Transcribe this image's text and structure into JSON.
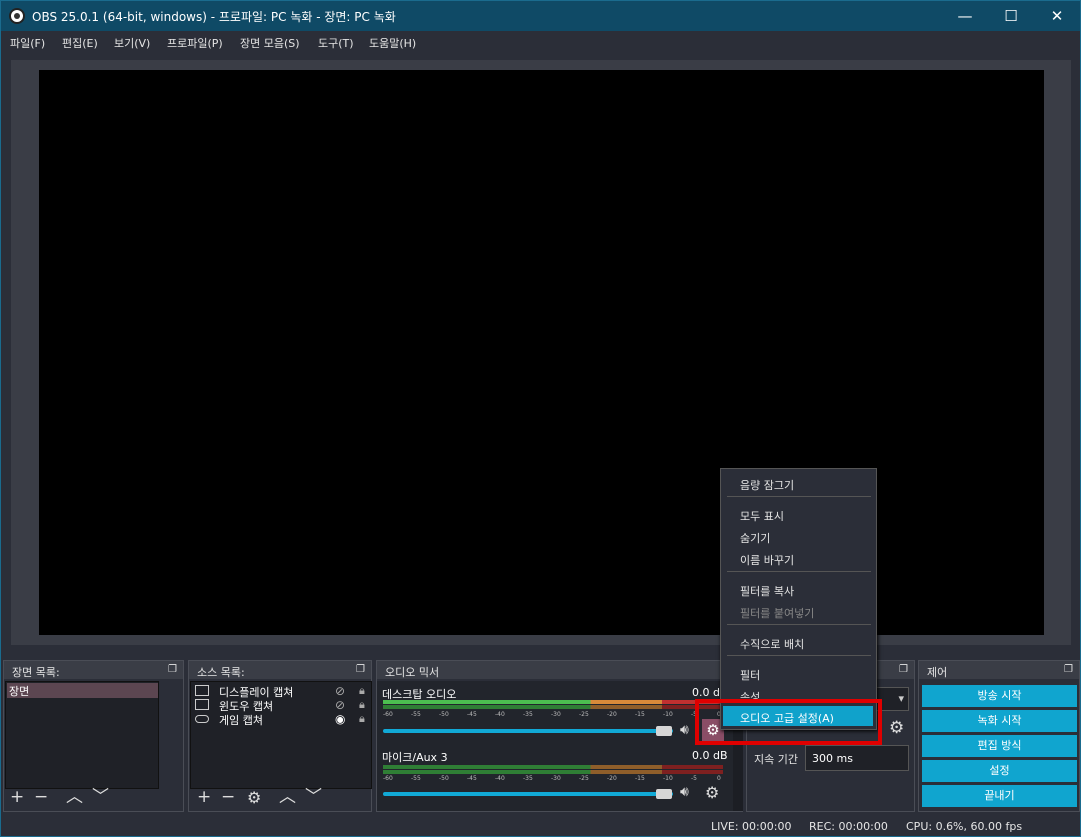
{
  "window": {
    "title": "OBS 25.0.1 (64-bit, windows) - 프로파일: PC 녹화 - 장면: PC 녹화",
    "minimize": "—",
    "maximize": "☐",
    "close": "✕"
  },
  "menu": [
    "파일(F)",
    "편집(E)",
    "보기(V)",
    "프로파일(P)",
    "장면 모음(S)",
    "도구(T)",
    "도움말(H)"
  ],
  "scenes": {
    "title": "장면 목록:",
    "items": [
      "장면"
    ]
  },
  "sources": {
    "title": "소스 목록:",
    "items": [
      {
        "label": "디스플레이 캡쳐",
        "icon": "monitor-icon"
      },
      {
        "label": "윈도우 캡쳐",
        "icon": "window-icon"
      },
      {
        "label": "게임 캡쳐",
        "icon": "gamepad-icon"
      }
    ]
  },
  "mixer": {
    "title": "오디오 믹서",
    "channels": [
      {
        "name": "데스크탑 오디오",
        "db": "0.0 dB"
      },
      {
        "name": "마이크/Aux 3",
        "db": "0.0 dB"
      }
    ],
    "ticks": [
      "-60",
      "-55",
      "-50",
      "-45",
      "-40",
      "-35",
      "-30",
      "-25",
      "-20",
      "-15",
      "-10",
      "-5",
      "0"
    ]
  },
  "transitions": {
    "duration_label": "지속 기간",
    "duration_value": "300 ms"
  },
  "controls": {
    "title": "제어",
    "buttons": [
      "방송 시작",
      "녹화 시작",
      "편집 방식",
      "설정",
      "끝내기"
    ]
  },
  "context_menu": {
    "items": [
      "음량 잠그기",
      "모두 표시",
      "숨기기",
      "이름 바꾸기",
      "필터를 복사",
      "필터를 붙여넣기",
      "수직으로 배치",
      "필터",
      "속성",
      "오디오 고급 설정(A)"
    ]
  },
  "status": {
    "live": "LIVE: 00:00:00",
    "rec": "REC: 00:00:00",
    "cpu": "CPU: 0.6%, 60.00 fps"
  }
}
